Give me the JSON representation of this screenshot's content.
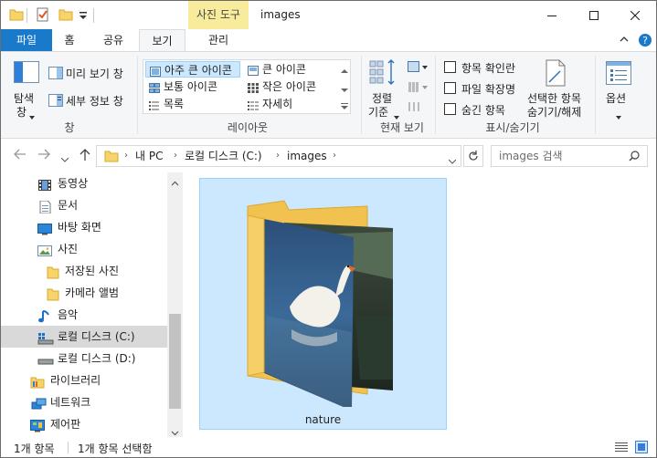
{
  "window": {
    "title": "images",
    "context_tab_header": "사진 도구"
  },
  "ribbon_tabs": [
    {
      "label": "파일"
    },
    {
      "label": "홈"
    },
    {
      "label": "공유"
    },
    {
      "label": "보기"
    },
    {
      "label": "관리"
    }
  ],
  "ribbon": {
    "pane_group": {
      "nav_pane_label": "탐색",
      "nav_pane_label2": "창",
      "preview_label": "미리 보기 창",
      "details_label": "세부 정보 창",
      "group_label": "창"
    },
    "layout_group": {
      "options": [
        {
          "label": "아주 큰 아이콘",
          "selected": true
        },
        {
          "label": "큰 아이콘",
          "selected": false
        },
        {
          "label": "보통 아이콘",
          "selected": false
        },
        {
          "label": "작은 아이콘",
          "selected": false
        },
        {
          "label": "목록",
          "selected": false
        },
        {
          "label": "자세히",
          "selected": false
        }
      ],
      "group_label": "레이아웃"
    },
    "current_view_group": {
      "sort_label": "정렬",
      "sort_label2": "기준",
      "group_label": "현재 보기"
    },
    "show_hide_group": {
      "checkboxes": [
        {
          "label": "항목 확인란",
          "checked": false
        },
        {
          "label": "파일 확장명",
          "checked": false
        },
        {
          "label": "숨긴 항목",
          "checked": false
        }
      ],
      "hide_selected_label": "선택한 항목",
      "hide_selected_label2": "숨기기/해제",
      "group_label": "표시/숨기기"
    },
    "options_group": {
      "label": "옵션"
    }
  },
  "address_bar": {
    "parts": [
      "내 PC",
      "로컬 디스크 (C:)",
      "images"
    ]
  },
  "search": {
    "placeholder": "images 검색"
  },
  "nav_tree": [
    {
      "label": "동영상",
      "icon": "video-icon",
      "indent": 1,
      "selected": false
    },
    {
      "label": "문서",
      "icon": "document-icon",
      "indent": 1,
      "selected": false
    },
    {
      "label": "바탕 화면",
      "icon": "desktop-icon",
      "indent": 1,
      "selected": false
    },
    {
      "label": "사진",
      "icon": "pictures-icon",
      "indent": 1,
      "selected": false
    },
    {
      "label": "저장된 사진",
      "icon": "folder-icon",
      "indent": 2,
      "selected": false
    },
    {
      "label": "카메라 앨범",
      "icon": "folder-icon",
      "indent": 2,
      "selected": false
    },
    {
      "label": "음악",
      "icon": "music-icon",
      "indent": 1,
      "selected": false
    },
    {
      "label": "로컬 디스크 (C:)",
      "icon": "drive-c-icon",
      "indent": 1,
      "selected": true
    },
    {
      "label": "로컬 디스크 (D:)",
      "icon": "drive-icon",
      "indent": 1,
      "selected": false
    },
    {
      "label": "라이브러리",
      "icon": "library-icon",
      "indent": 0,
      "selected": false
    },
    {
      "label": "네트워크",
      "icon": "network-icon",
      "indent": 0,
      "selected": false
    },
    {
      "label": "제어판",
      "icon": "control-panel-icon",
      "indent": 0,
      "selected": false
    }
  ],
  "content": {
    "items": [
      {
        "name": "nature",
        "type": "folder",
        "selected": true
      }
    ]
  },
  "status_bar": {
    "item_count": "1개 항목",
    "selected_count": "1개 항목 선택함"
  },
  "colors": {
    "file_tab": "#1979ca",
    "context_tab": "#f8ec9c",
    "selection": "#cce8ff",
    "selection_border": "#99d1ff"
  }
}
